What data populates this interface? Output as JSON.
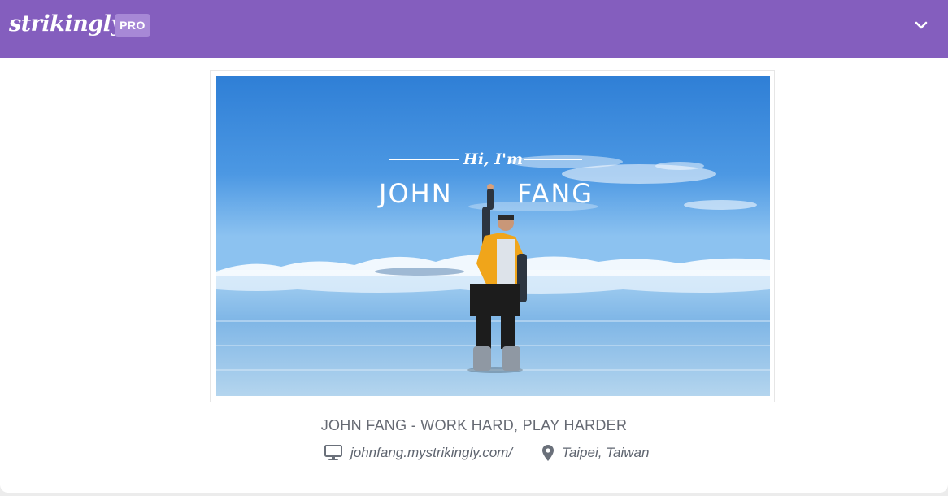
{
  "header": {
    "logo_text": "strikingly",
    "badge": "PRO",
    "toggle_icon": "chevron-down-icon",
    "background": "#845ebe"
  },
  "hero": {
    "greeting": "Hi, I'm",
    "first_name": "JOHN",
    "last_name": "FANG"
  },
  "site": {
    "title": "JOHN FANG - WORK HARD, PLAY HARDER",
    "url": "johnfang.mystrikingly.com/",
    "location": "Taipei, Taiwan",
    "url_icon": "monitor-icon",
    "location_icon": "map-pin-icon"
  }
}
